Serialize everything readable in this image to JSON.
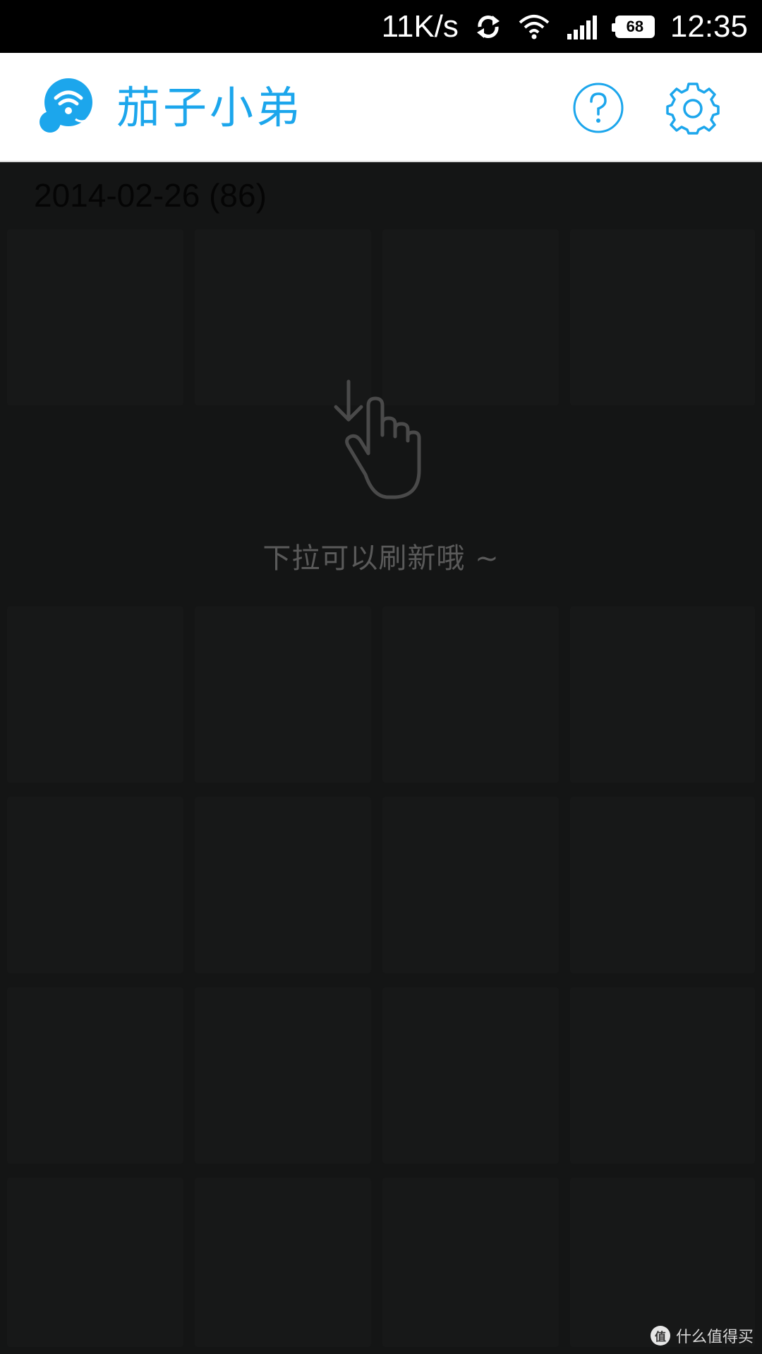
{
  "status_bar": {
    "net_speed": "11K/s",
    "battery_level": "68",
    "time": "12:35",
    "icons": [
      "sync-icon",
      "wifi-icon",
      "signal-icon",
      "battery-icon"
    ]
  },
  "header": {
    "app_title": "茄子小弟",
    "accent_color": "#1ca6ec",
    "help_icon": "question-icon",
    "settings_icon": "gear-icon"
  },
  "content": {
    "date_label": "2014-02-26 (86)",
    "pull_hint": "下拉可以刷新哦 ~",
    "hint_icon": "pull-down-hand-icon"
  },
  "watermark": {
    "text": "什么值得买"
  }
}
